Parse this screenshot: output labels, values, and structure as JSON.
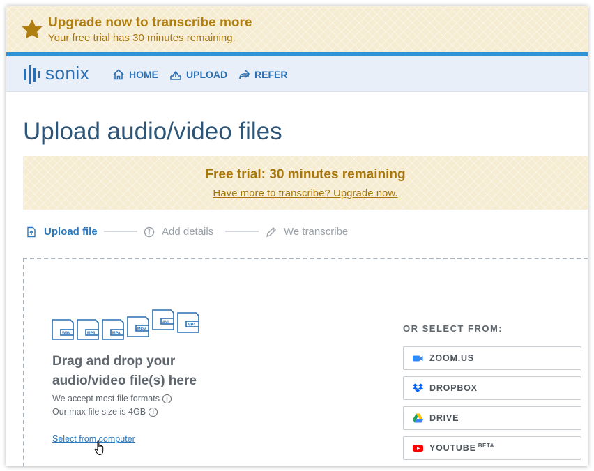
{
  "banner": {
    "title": "Upgrade now to transcribe more",
    "subtitle": "Your free trial has 30 minutes remaining."
  },
  "nav": {
    "logo_text": "sonix",
    "items": [
      {
        "label": "HOME",
        "icon": "home-icon"
      },
      {
        "label": "UPLOAD",
        "icon": "upload-icon"
      },
      {
        "label": "REFER",
        "icon": "share-icon"
      }
    ]
  },
  "page": {
    "title": "Upload audio/video files"
  },
  "trial": {
    "title": "Free trial: 30 minutes remaining",
    "link": "Have more to transcribe? Upgrade now."
  },
  "steps": [
    {
      "label": "Upload file",
      "icon": "upload-file-icon",
      "active": true
    },
    {
      "label": "Add details",
      "icon": "info-icon",
      "active": false
    },
    {
      "label": "We transcribe",
      "icon": "pencil-icon",
      "active": false
    }
  ],
  "dropzone": {
    "file_types": [
      "WAV",
      "MP3",
      "MPA",
      "MOV",
      "AVI",
      "MP4"
    ],
    "title": "Drag and drop your audio/video file(s) here",
    "formats_text": "We accept most file formats",
    "size_text": "Our max file size is 4GB",
    "select_link": "Select from computer"
  },
  "sources": {
    "heading": "OR SELECT FROM:",
    "items": [
      {
        "label": "ZOOM.US",
        "icon": "zoom-icon"
      },
      {
        "label": "DROPBOX",
        "icon": "dropbox-icon"
      },
      {
        "label": "DRIVE",
        "icon": "google-drive-icon"
      },
      {
        "label": "YOUTUBE",
        "badge": "BETA",
        "icon": "youtube-icon"
      }
    ]
  },
  "colors": {
    "accent": "#2a78bd",
    "banner_bg": "#f6ecd2",
    "banner_text": "#b07f12",
    "nav_bg": "#e8eff8",
    "blue_line": "#2f92d4"
  }
}
